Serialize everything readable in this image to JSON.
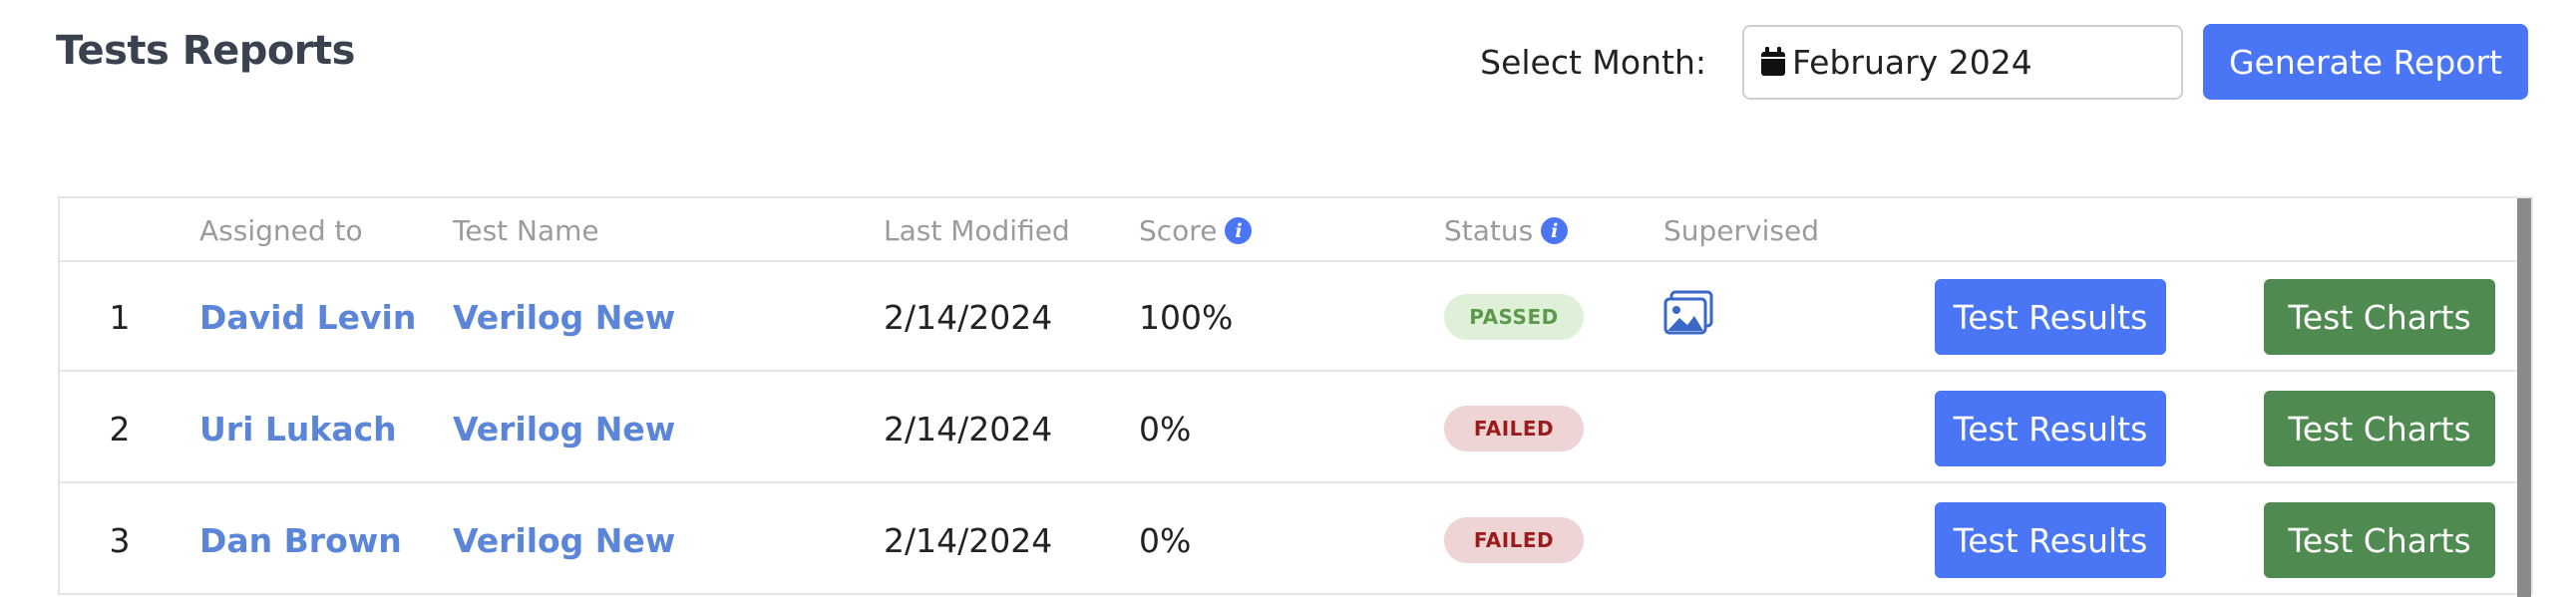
{
  "page": {
    "title": "Tests Reports"
  },
  "controls": {
    "month_label": "Select Month:",
    "month_value": "February 2024",
    "generate_label": "Generate Report"
  },
  "table": {
    "headers": {
      "num": "",
      "assigned": "Assigned to",
      "test_name": "Test Name",
      "last_modified": "Last Modified",
      "score": "Score",
      "status": "Status",
      "supervised": "Supervised"
    },
    "rows": [
      {
        "num": "1",
        "assigned": "David Levin",
        "test_name": "Verilog New",
        "last_modified": "2/14/2024",
        "score": "100%",
        "status": "PASSED",
        "supervised": true,
        "results_label": "Test Results",
        "charts_label": "Test Charts"
      },
      {
        "num": "2",
        "assigned": "Uri Lukach",
        "test_name": "Verilog New",
        "last_modified": "2/14/2024",
        "score": "0%",
        "status": "FAILED",
        "supervised": false,
        "results_label": "Test Results",
        "charts_label": "Test Charts"
      },
      {
        "num": "3",
        "assigned": "Dan Brown",
        "test_name": "Verilog New",
        "last_modified": "2/14/2024",
        "score": "0%",
        "status": "FAILED",
        "supervised": false,
        "results_label": "Test Results",
        "charts_label": "Test Charts"
      }
    ]
  },
  "colors": {
    "primary": "#4a75f5",
    "success": "#4f8a50",
    "link": "#5a85d8",
    "passed_bg": "#dff0d8",
    "passed_text": "#5a9a4a",
    "failed_bg": "#eed4d4",
    "failed_text": "#9b1c1c"
  },
  "icons": {
    "calendar": "calendar-icon",
    "info": "info-icon",
    "supervised": "image-gallery-icon"
  }
}
